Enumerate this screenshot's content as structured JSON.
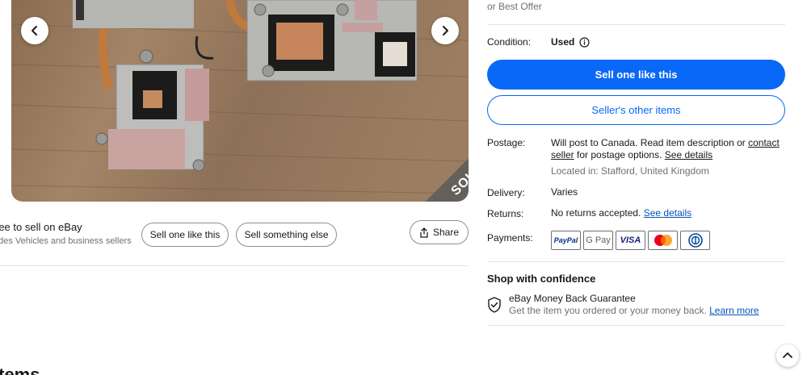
{
  "gallery": {
    "sold_label": "SOLD",
    "prev_icon": "chevron-left-icon",
    "next_icon": "chevron-right-icon"
  },
  "sell_bar": {
    "title": "ree to sell on eBay",
    "subtitle": "udes Vehicles and business sellers",
    "sell_one_label": "Sell one like this",
    "sell_else_label": "Sell something else",
    "share_label": "Share",
    "share_icon": "share-icon"
  },
  "items_heading": "items",
  "listing": {
    "best_offer": "or Best Offer",
    "condition_label": "Condition:",
    "condition_value": "Used",
    "info_icon": "info-icon",
    "primary_button": "Sell one like this",
    "secondary_button": "Seller's other items",
    "postage_label": "Postage:",
    "postage_text_1": "Will post to Canada. Read item description or ",
    "postage_link_contact": "contact",
    "postage_link_seller": "seller",
    "postage_text_2": " for postage options. ",
    "postage_see_details": "See details",
    "located_in": "Located in: Stafford, United Kingdom",
    "delivery_label": "Delivery:",
    "delivery_value": "Varies",
    "returns_label": "Returns:",
    "returns_value": "No returns accepted. ",
    "returns_see_details": "See details",
    "payments_label": "Payments:",
    "payments": [
      "PayPal",
      "G Pay",
      "VISA",
      "Mastercard",
      "Diners Club"
    ],
    "confidence_title": "Shop with confidence",
    "guarantee_title": "eBay Money Back Guarantee",
    "guarantee_sub": "Get the item you ordered or your money back. ",
    "learn_more": "Learn more",
    "shield_icon": "shield-check-icon"
  },
  "back_to_top_icon": "chevron-up-icon",
  "colors": {
    "primary": "#0968f6",
    "link": "#0654ba",
    "muted": "#707070",
    "sold_band": "#5a5a5a"
  }
}
